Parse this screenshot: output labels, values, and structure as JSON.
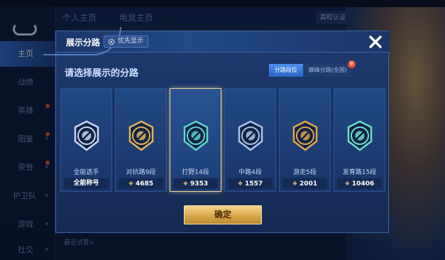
{
  "sidebar": {
    "items": [
      {
        "label": "主页",
        "active": true
      },
      {
        "label": "战绩"
      },
      {
        "label": "英雄"
      },
      {
        "label": "图鉴"
      },
      {
        "label": "荣誉"
      },
      {
        "label": "护卫队"
      },
      {
        "label": "游戏"
      },
      {
        "label": "社交"
      }
    ]
  },
  "top_tabs": [
    "个人主页",
    "电竞主页"
  ],
  "top_right": [
    "高校认证"
  ],
  "bottom_text": "最近访客>",
  "modal": {
    "title": "展示分路",
    "priority_button": "优先显示",
    "subtitle": "请选择展示的分路",
    "tabs": [
      {
        "label": "分路段位",
        "active": true
      },
      {
        "label": "巅峰分路(全国)",
        "badge": "新"
      }
    ],
    "cards": [
      {
        "label": "全能选手",
        "score": "全能称号",
        "emblem": "allround-emblem",
        "color": "#c8d8f0",
        "selected": false,
        "chevron": false
      },
      {
        "label": "对抗路9段",
        "score": "4685",
        "emblem": "clash-lane-emblem",
        "color": "#e2b45a",
        "selected": false,
        "chevron": true
      },
      {
        "label": "打野14段",
        "score": "9353",
        "emblem": "jungle-emblem",
        "color": "#5fd6c8",
        "selected": true,
        "chevron": true
      },
      {
        "label": "中路4段",
        "score": "1557",
        "emblem": "mid-lane-emblem",
        "color": "#a9c4e8",
        "selected": false,
        "chevron": true
      },
      {
        "label": "游走5段",
        "score": "2001",
        "emblem": "roam-emblem",
        "color": "#e2a64a",
        "selected": false,
        "chevron": true
      },
      {
        "label": "发育路15段",
        "score": "10406",
        "emblem": "farm-lane-emblem",
        "color": "#6fe0c8",
        "selected": false,
        "chevron": true
      }
    ],
    "confirm_button": "确定"
  }
}
